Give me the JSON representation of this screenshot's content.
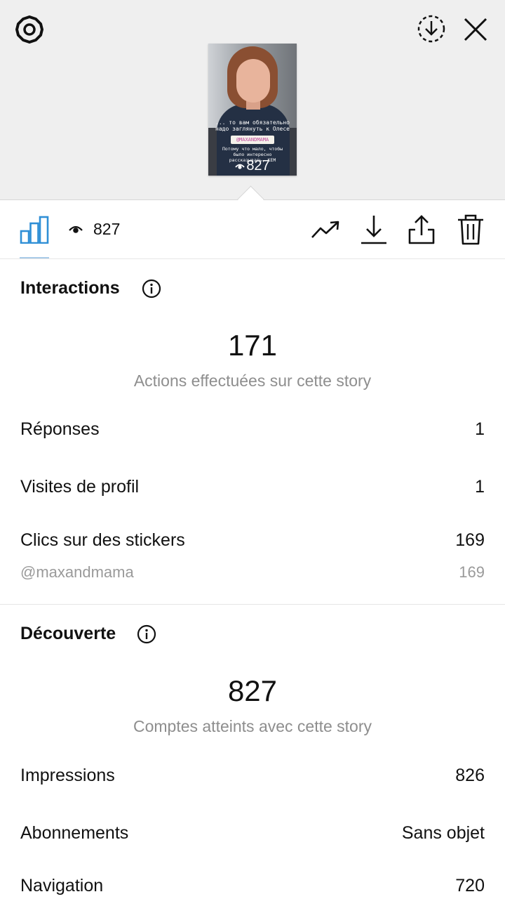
{
  "preview": {
    "caption_top": "... то вам обязательно надо заглянуть к Олесе",
    "mention_tag": "@MAXANDMAMA",
    "caption_bottom": "Потому что мало, чтобы было интересно рассказывать, КЕМ",
    "views": "827"
  },
  "toolbar": {
    "views_count": "827",
    "icons": [
      "bar-chart-icon",
      "eye-icon",
      "trending-icon",
      "download-icon",
      "share-icon",
      "trash-icon"
    ],
    "accent_color": "#2f8fd6"
  },
  "interactions": {
    "title": "Interactions",
    "total": "171",
    "subtitle": "Actions effectuées sur cette story",
    "rows": [
      {
        "label": "Réponses",
        "value": "1"
      },
      {
        "label": "Visites de profil",
        "value": "1"
      },
      {
        "label": "Clics sur des stickers",
        "value": "169"
      }
    ],
    "sticker_detail": {
      "label": "@maxandmama",
      "value": "169"
    }
  },
  "discovery": {
    "title": "Découverte",
    "total": "827",
    "subtitle": "Comptes atteints avec cette story",
    "rows": [
      {
        "label": "Impressions",
        "value": "826"
      },
      {
        "label": "Abonnements",
        "value": "Sans objet"
      },
      {
        "label": "Navigation",
        "value": "720"
      }
    ]
  }
}
